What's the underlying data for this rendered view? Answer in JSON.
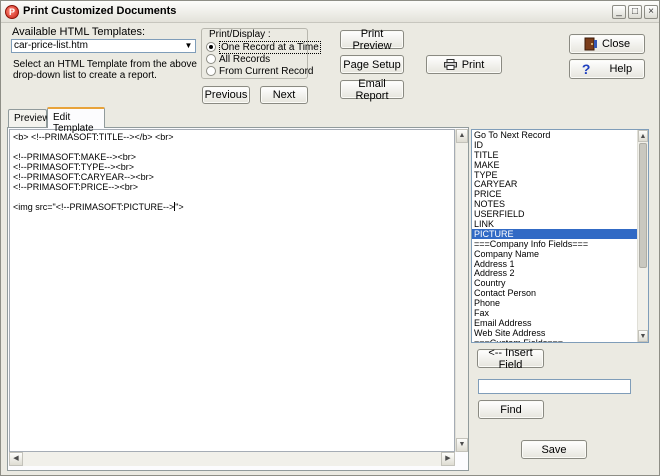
{
  "window": {
    "title": "Print Customized Documents"
  },
  "titlebar": {
    "minimize": "_",
    "maximize": "□",
    "close": "×"
  },
  "templates": {
    "label": "Available HTML Templates:",
    "selected": "car-price-list.htm",
    "help_line1": "Select an HTML Template from the above",
    "help_line2": "drop-down list to create a report."
  },
  "print_display": {
    "title": "Print/Display :",
    "options": [
      "One Record at a Time",
      "All Records",
      "From Current Record"
    ],
    "selected_index": 0
  },
  "buttons": {
    "previous": "Previous",
    "next": "Next",
    "print_preview": "Print Preview",
    "page_setup": "Page Setup",
    "email_report": "Email Report",
    "print": "Print",
    "close": "Close",
    "help": "Help",
    "insert_field": "<-- Insert Field",
    "find": "Find",
    "save": "Save"
  },
  "tabs": [
    "Preview",
    "Edit Template"
  ],
  "active_tab": 1,
  "template_lines": [
    "<b> <!--PRIMASOFT:TITLE--></b> <br>",
    "",
    "<!--PRIMASOFT:MAKE--><br>",
    "<!--PRIMASOFT:TYPE--><br>",
    "<!--PRIMASOFT:CARYEAR--><br>",
    "<!--PRIMASOFT:PRICE--><br>",
    "",
    "<img src=\"<!--PRIMASOFT:PICTURE-->\">"
  ],
  "fields": [
    "Go To Next Record",
    "ID",
    "TITLE",
    "MAKE",
    "TYPE",
    "CARYEAR",
    "PRICE",
    "NOTES",
    "USERFIELD",
    "LINK",
    "PICTURE",
    "===Company Info Fields===",
    "Company Name",
    "Address 1",
    "Address 2",
    "Country",
    "Contact Person",
    "Phone",
    "Fax",
    "Email Address",
    "Web Site Address",
    "===Custom Fields==="
  ],
  "selected_field_index": 10,
  "search": {
    "value": ""
  },
  "colors": {
    "selection": "#316ac5",
    "tab_accent": "#e8a33a"
  }
}
